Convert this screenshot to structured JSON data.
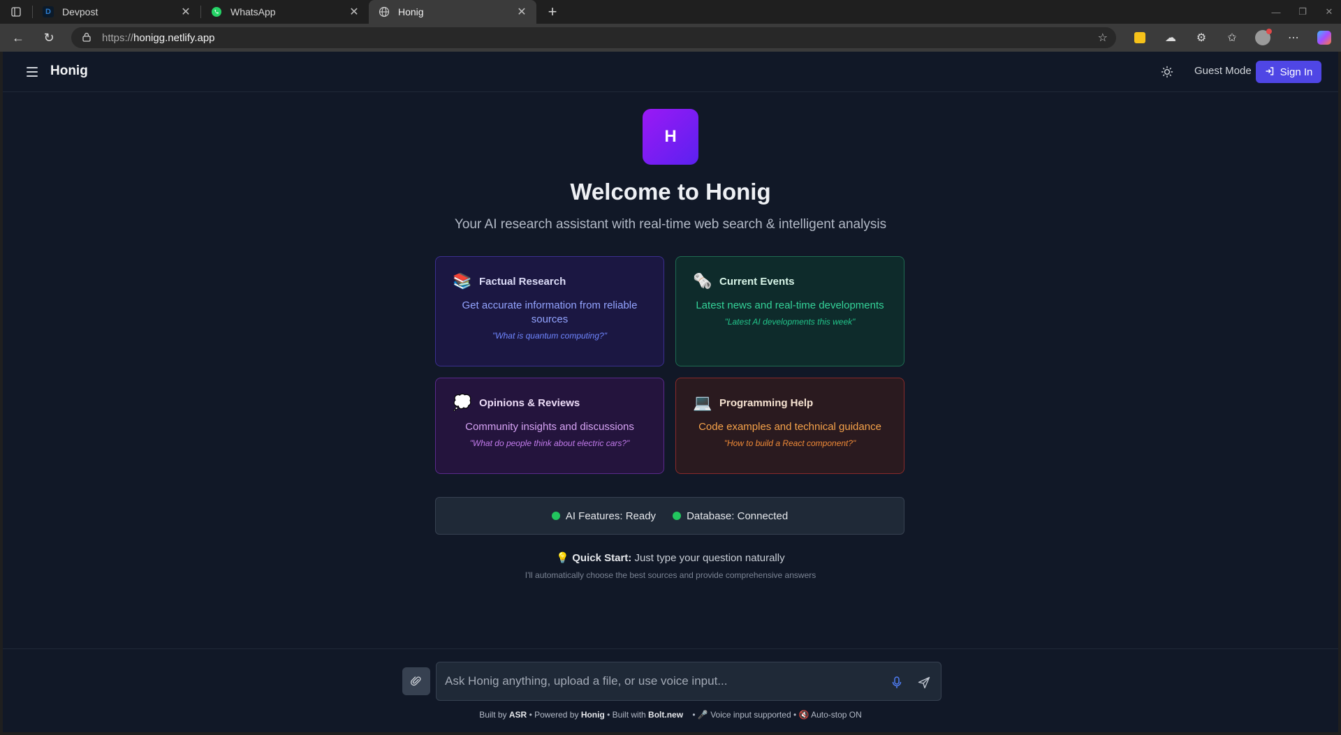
{
  "browser": {
    "tabs": [
      {
        "title": "Devpost",
        "favicon": "D",
        "favicon_color": "#2d7fd3"
      },
      {
        "title": "WhatsApp",
        "favicon": "whatsapp-icon",
        "favicon_color": "#25d366"
      },
      {
        "title": "Honig",
        "favicon": "globe-icon",
        "favicon_color": "#cfcfcf"
      }
    ],
    "url_scheme": "https://",
    "url_host": "honigg.netlify.app"
  },
  "header": {
    "brand": "Honig",
    "guest_mode": "Guest Mode",
    "sign_in": "Sign In"
  },
  "hero": {
    "logo_letter": "H",
    "title": "Welcome to Honig",
    "subtitle": "Your AI research assistant with real-time web search & intelligent analysis"
  },
  "cards": [
    {
      "emoji": "📚",
      "title": "Factual Research",
      "description": "Get accurate information from reliable sources",
      "example": "\"What is quantum computing?\""
    },
    {
      "emoji": "🗞️",
      "title": "Current Events",
      "description": "Latest news and real-time developments",
      "example": "\"Latest AI developments this week\""
    },
    {
      "emoji": "💭",
      "title": "Opinions & Reviews",
      "description": "Community insights and discussions",
      "example": "\"What do people think about electric cars?\""
    },
    {
      "emoji": "💻",
      "title": "Programming Help",
      "description": "Code examples and technical guidance",
      "example": "\"How to build a React component?\""
    }
  ],
  "status": {
    "ai": "AI Features: Ready",
    "db": "Database: Connected",
    "color": "#22c55e"
  },
  "quick_start": {
    "emoji": "💡",
    "label": "Quick Start:",
    "text": " Just type your question naturally",
    "sub": "I'll automatically choose the best sources and provide comprehensive answers"
  },
  "input": {
    "placeholder": "Ask Honig anything, upload a file, or use voice input..."
  },
  "footer": {
    "built_by_prefix": "Built by ",
    "built_by": "ASR",
    "powered_prefix": " • Powered by ",
    "powered": "Honig",
    "built_with_prefix": " • Built with ",
    "built_with": "Bolt.new",
    "voice": "    • 🎤 Voice input supported • 🔇 Auto-stop ON"
  }
}
